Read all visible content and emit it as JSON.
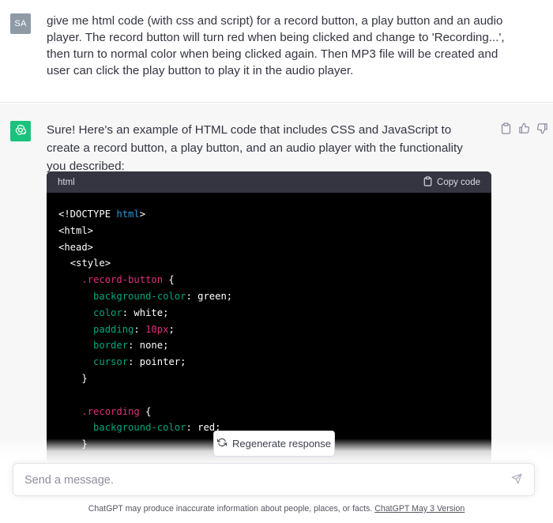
{
  "user": {
    "avatar_initials": "SA",
    "message": "give me html code (with css and script) for a record button, a play button and an audio player. The record button will turn red when being clicked and change to 'Recording...', then turn to normal color when being clicked again. Then MP3 file will be created and user can click the play button to play it in the audio player."
  },
  "assistant": {
    "avatar_icon": "openai-logo-icon",
    "message": "Sure! Here's an example of HTML code that includes CSS and JavaScript to create a record button, a play button, and an audio player with the functionality you described:",
    "code_block": {
      "language": "html",
      "copy_label": "Copy code",
      "lines": {
        "l1_a": "<!DOCTYPE ",
        "l1_b": "html",
        "l1_c": ">",
        "l2": "<html>",
        "l3": "<head>",
        "l4": "<style>",
        "l5_sel": ".record-button",
        "l5_brace": " {",
        "l6_prop": "background-color",
        "l6_val": ": green;",
        "l7_prop": "color",
        "l7_val": ": white;",
        "l8_prop": "padding",
        "l8_colon": ": ",
        "l8_num": "10px",
        "l8_semi": ";",
        "l9_prop": "border",
        "l9_val": ": none;",
        "l10_prop": "cursor",
        "l10_val": ": pointer;",
        "l11": "}",
        "l13_sel": ".recording",
        "l13_brace": " {",
        "l14_prop": "background-color",
        "l14_val": ": red;",
        "l15": "}"
      }
    }
  },
  "regenerate_label": "Regenerate response",
  "input": {
    "placeholder": "Send a message."
  },
  "footer": {
    "text": "ChatGPT may produce inaccurate information about people, places, or facts. ",
    "link": "ChatGPT May 3 Version"
  },
  "colors": {
    "accent_green": "#19c37d",
    "code_keyword": "#2e95d3",
    "code_selector": "#df3079",
    "code_property": "#00a67d"
  }
}
